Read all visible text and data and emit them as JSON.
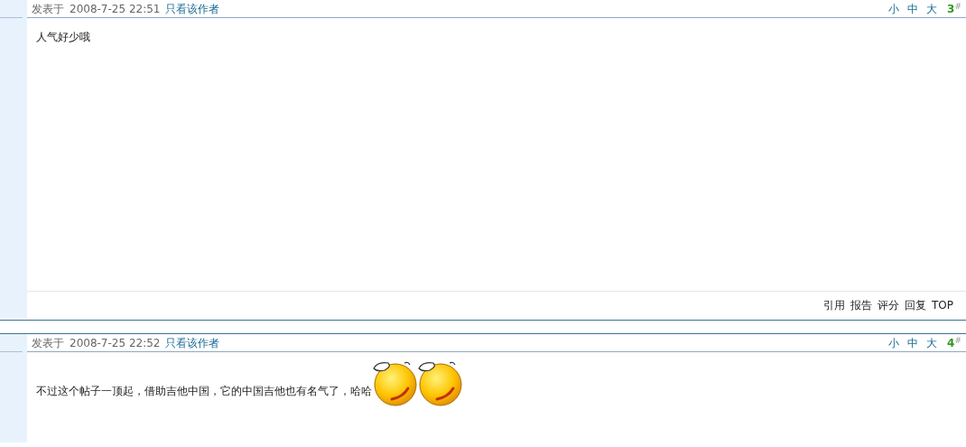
{
  "posts": [
    {
      "posted_label": "发表于",
      "time": "2008-7-25 22:51",
      "author_only_link": "只看该作者",
      "font_sizes": [
        "小",
        "中",
        "大"
      ],
      "floor": "3",
      "floor_mark": "#",
      "body": "人气好少哦",
      "actions": [
        "引用",
        "报告",
        "评分",
        "回复",
        "TOP"
      ]
    },
    {
      "posted_label": "发表于",
      "time": "2008-7-25 22:52",
      "author_only_link": "只看该作者",
      "font_sizes": [
        "小",
        "中",
        "大"
      ],
      "floor": "4",
      "floor_mark": "#",
      "body": "不过这个帖子一顶起，借助吉他中国，它的中国吉他也有名气了，哈哈",
      "inline_images": [
        {
          "kind": "emoticon"
        },
        {
          "kind": "emoticon"
        }
      ]
    }
  ]
}
